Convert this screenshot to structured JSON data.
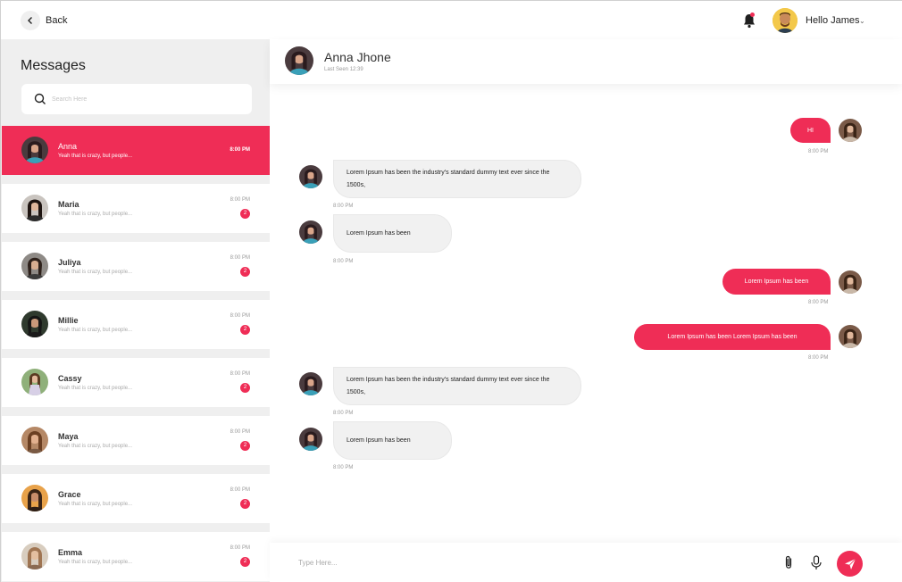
{
  "topbar": {
    "back_label": "Back",
    "user_greeting": "Hello James"
  },
  "sidebar": {
    "title": "Messages",
    "search_placeholder": "Search Here",
    "contacts": [
      {
        "name": "Anna",
        "preview": "Yeah that is crazy, but people...",
        "time": "8:00 PM",
        "unread": "",
        "active": true
      },
      {
        "name": "Maria",
        "preview": "Yeah that is crazy, but people...",
        "time": "8:00 PM",
        "unread": "2"
      },
      {
        "name": "Juliya",
        "preview": "Yeah that is crazy, but people...",
        "time": "8:00 PM",
        "unread": "2"
      },
      {
        "name": "Millie",
        "preview": "Yeah that is crazy, but people...",
        "time": "8:00 PM",
        "unread": "2"
      },
      {
        "name": "Cassy",
        "preview": "Yeah that is crazy, but people...",
        "time": "8:00 PM",
        "unread": "2"
      },
      {
        "name": "Maya",
        "preview": "Yeah that is crazy, but people...",
        "time": "8:00 PM",
        "unread": "2"
      },
      {
        "name": "Grace",
        "preview": "Yeah that is crazy, but people...",
        "time": "8:00 PM",
        "unread": "2"
      },
      {
        "name": "Emma",
        "preview": "Yeah that is crazy, but people...",
        "time": "8:00 PM",
        "unread": "2"
      }
    ]
  },
  "chat": {
    "contact_name": "Anna Jhone",
    "last_seen": "Last Seen 12:39",
    "messages": [
      {
        "dir": "out",
        "text": "HI",
        "time": "8:00 PM"
      },
      {
        "dir": "in",
        "text": "Lorem Ipsum has been the industry's standard dummy text ever since the 1500s,",
        "time": "8:00 PM"
      },
      {
        "dir": "in",
        "text": "Lorem Ipsum has been",
        "time": "8:00 PM"
      },
      {
        "dir": "out",
        "text": "Lorem Ipsum has been",
        "time": "8:00 PM"
      },
      {
        "dir": "out",
        "text": "Lorem Ipsum has been Lorem Ipsum has been",
        "time": "8:00 PM"
      },
      {
        "dir": "in",
        "text": "Lorem Ipsum has been the industry's standard dummy text ever since the 1500s,",
        "time": "8:00 PM"
      },
      {
        "dir": "in",
        "text": "Lorem Ipsum has been",
        "time": "8:00 PM"
      }
    ],
    "composer_placeholder": "Type Here..."
  },
  "colors": {
    "accent": "#ef2d56",
    "sidebar_bg": "#efefef",
    "bubble_in": "#f1f1f1"
  },
  "icons": [
    "chevron-left-icon",
    "bell-icon",
    "chevron-down-icon",
    "search-icon",
    "paperclip-icon",
    "microphone-icon",
    "send-icon"
  ]
}
